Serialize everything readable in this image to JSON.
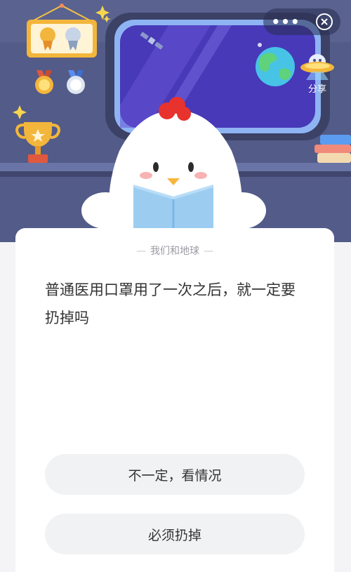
{
  "header": {
    "more_icon": "more-dots-icon",
    "close_icon": "close-circle-icon",
    "share_label": "分享"
  },
  "quiz": {
    "category": "我们和地球",
    "question": "普通医用口罩用了一次之后，就一定要扔掉吗",
    "answers": [
      {
        "label": "不一定，看情况"
      },
      {
        "label": "必须扔掉"
      }
    ]
  },
  "colors": {
    "hero_bg": "#525a86",
    "card_bg": "#ffffff",
    "answer_bg": "#f1f2f4",
    "text": "#333333",
    "muted": "#9a9aa3"
  }
}
